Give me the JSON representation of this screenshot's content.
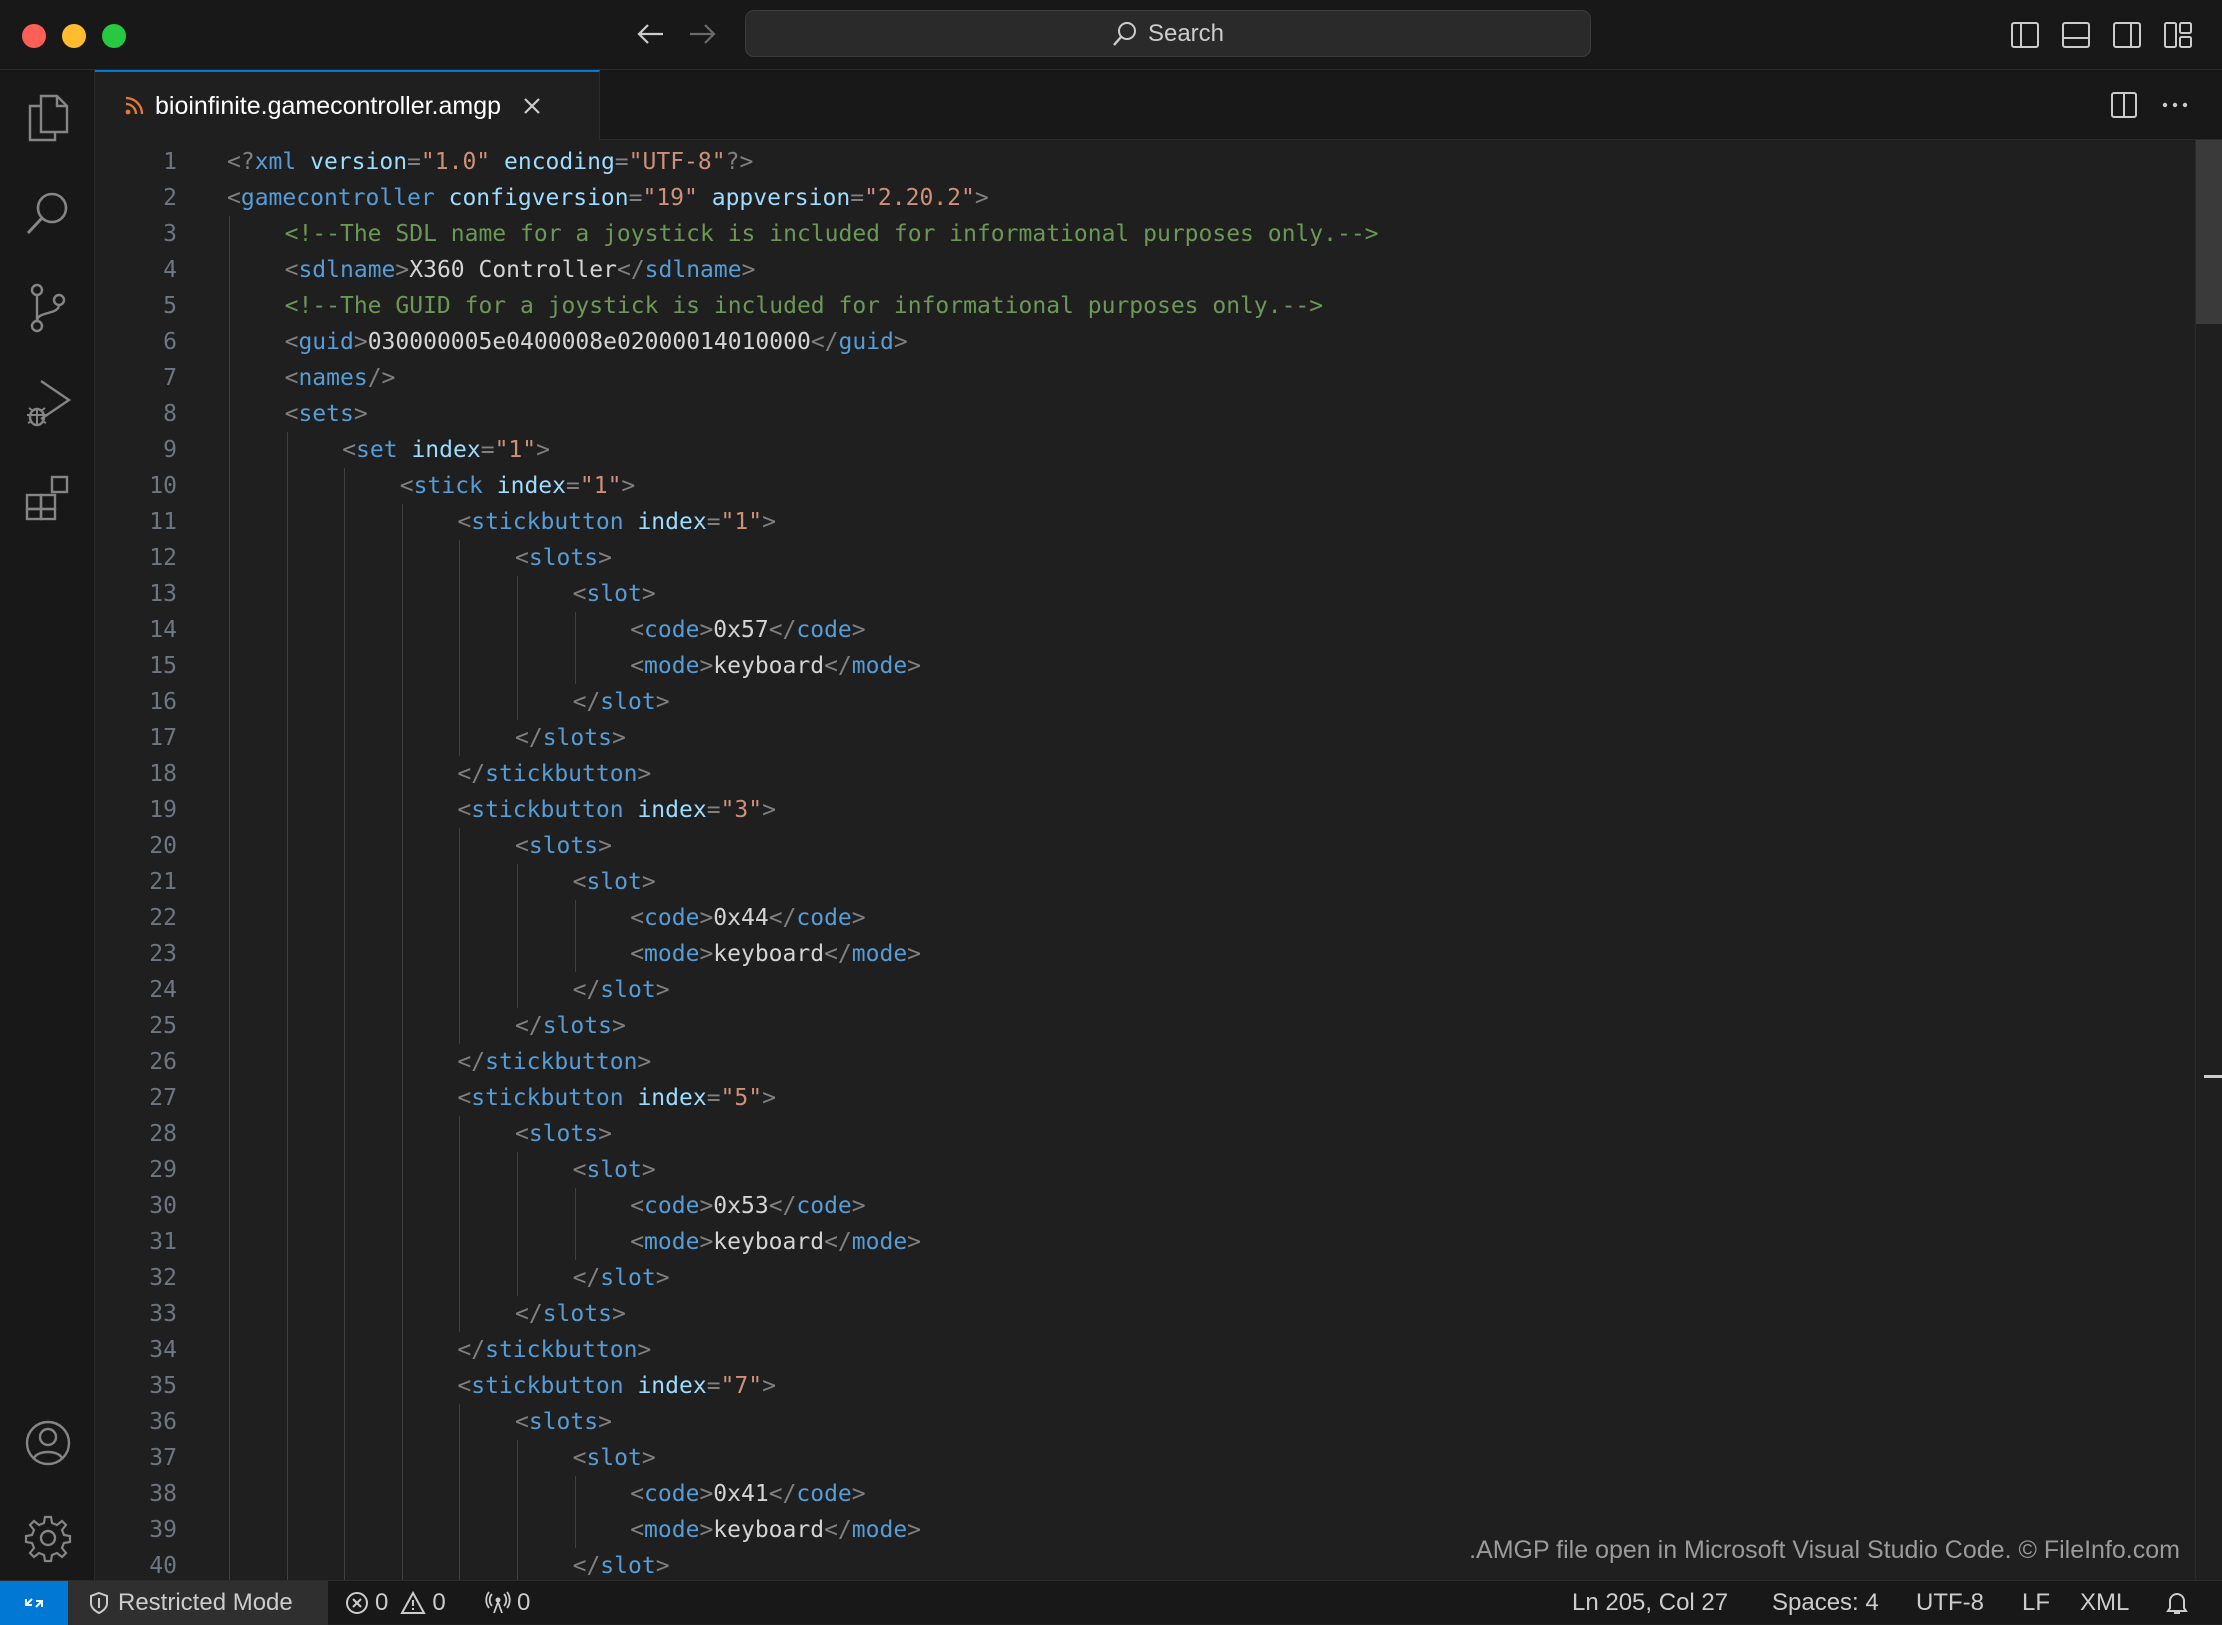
{
  "window": {
    "traffic_colors": {
      "close": "#ff5f57",
      "minimize": "#febc2e",
      "maximize": "#28c840"
    }
  },
  "titlebar": {
    "search_label": "Search"
  },
  "tab": {
    "filename": "bioinfinite.gamecontroller.amgp",
    "icon": "rss-icon"
  },
  "editor": {
    "lines": [
      {
        "n": "1",
        "depth": 0,
        "t": [
          [
            "b",
            "<?"
          ],
          [
            "n",
            "xml"
          ],
          [
            "x",
            " "
          ],
          [
            "a",
            "version"
          ],
          [
            "b",
            "="
          ],
          [
            "s",
            "\"1.0\""
          ],
          [
            "x",
            " "
          ],
          [
            "a",
            "encoding"
          ],
          [
            "b",
            "="
          ],
          [
            "s",
            "\"UTF-8\""
          ],
          [
            "b",
            "?>"
          ]
        ]
      },
      {
        "n": "2",
        "depth": 0,
        "t": [
          [
            "b",
            "<"
          ],
          [
            "n",
            "gamecontroller"
          ],
          [
            "x",
            " "
          ],
          [
            "a",
            "configversion"
          ],
          [
            "b",
            "="
          ],
          [
            "s",
            "\"19\""
          ],
          [
            "x",
            " "
          ],
          [
            "a",
            "appversion"
          ],
          [
            "b",
            "="
          ],
          [
            "s",
            "\"2.20.2\""
          ],
          [
            "b",
            ">"
          ]
        ]
      },
      {
        "n": "3",
        "depth": 1,
        "t": [
          [
            "c",
            "<!--The SDL name for a joystick is included for informational purposes only.-->"
          ]
        ]
      },
      {
        "n": "4",
        "depth": 1,
        "t": [
          [
            "b",
            "<"
          ],
          [
            "n",
            "sdlname"
          ],
          [
            "b",
            ">"
          ],
          [
            "x",
            "X360 Controller"
          ],
          [
            "b",
            "</"
          ],
          [
            "n",
            "sdlname"
          ],
          [
            "b",
            ">"
          ]
        ]
      },
      {
        "n": "5",
        "depth": 1,
        "t": [
          [
            "c",
            "<!--The GUID for a joystick is included for informational purposes only.-->"
          ]
        ]
      },
      {
        "n": "6",
        "depth": 1,
        "t": [
          [
            "b",
            "<"
          ],
          [
            "n",
            "guid"
          ],
          [
            "b",
            ">"
          ],
          [
            "x",
            "030000005e0400008e02000014010000"
          ],
          [
            "b",
            "</"
          ],
          [
            "n",
            "guid"
          ],
          [
            "b",
            ">"
          ]
        ]
      },
      {
        "n": "7",
        "depth": 1,
        "t": [
          [
            "b",
            "<"
          ],
          [
            "n",
            "names"
          ],
          [
            "b",
            "/>"
          ]
        ]
      },
      {
        "n": "8",
        "depth": 1,
        "t": [
          [
            "b",
            "<"
          ],
          [
            "n",
            "sets"
          ],
          [
            "b",
            ">"
          ]
        ]
      },
      {
        "n": "9",
        "depth": 2,
        "t": [
          [
            "b",
            "<"
          ],
          [
            "n",
            "set"
          ],
          [
            "x",
            " "
          ],
          [
            "a",
            "index"
          ],
          [
            "b",
            "="
          ],
          [
            "s",
            "\"1\""
          ],
          [
            "b",
            ">"
          ]
        ]
      },
      {
        "n": "10",
        "depth": 3,
        "t": [
          [
            "b",
            "<"
          ],
          [
            "n",
            "stick"
          ],
          [
            "x",
            " "
          ],
          [
            "a",
            "index"
          ],
          [
            "b",
            "="
          ],
          [
            "s",
            "\"1\""
          ],
          [
            "b",
            ">"
          ]
        ]
      },
      {
        "n": "11",
        "depth": 4,
        "t": [
          [
            "b",
            "<"
          ],
          [
            "n",
            "stickbutton"
          ],
          [
            "x",
            " "
          ],
          [
            "a",
            "index"
          ],
          [
            "b",
            "="
          ],
          [
            "s",
            "\"1\""
          ],
          [
            "b",
            ">"
          ]
        ]
      },
      {
        "n": "12",
        "depth": 5,
        "t": [
          [
            "b",
            "<"
          ],
          [
            "n",
            "slots"
          ],
          [
            "b",
            ">"
          ]
        ]
      },
      {
        "n": "13",
        "depth": 6,
        "t": [
          [
            "b",
            "<"
          ],
          [
            "n",
            "slot"
          ],
          [
            "b",
            ">"
          ]
        ]
      },
      {
        "n": "14",
        "depth": 7,
        "t": [
          [
            "b",
            "<"
          ],
          [
            "n",
            "code"
          ],
          [
            "b",
            ">"
          ],
          [
            "x",
            "0x57"
          ],
          [
            "b",
            "</"
          ],
          [
            "n",
            "code"
          ],
          [
            "b",
            ">"
          ]
        ]
      },
      {
        "n": "15",
        "depth": 7,
        "t": [
          [
            "b",
            "<"
          ],
          [
            "n",
            "mode"
          ],
          [
            "b",
            ">"
          ],
          [
            "x",
            "keyboard"
          ],
          [
            "b",
            "</"
          ],
          [
            "n",
            "mode"
          ],
          [
            "b",
            ">"
          ]
        ]
      },
      {
        "n": "16",
        "depth": 6,
        "t": [
          [
            "b",
            "</"
          ],
          [
            "n",
            "slot"
          ],
          [
            "b",
            ">"
          ]
        ]
      },
      {
        "n": "17",
        "depth": 5,
        "t": [
          [
            "b",
            "</"
          ],
          [
            "n",
            "slots"
          ],
          [
            "b",
            ">"
          ]
        ]
      },
      {
        "n": "18",
        "depth": 4,
        "t": [
          [
            "b",
            "</"
          ],
          [
            "n",
            "stickbutton"
          ],
          [
            "b",
            ">"
          ]
        ]
      },
      {
        "n": "19",
        "depth": 4,
        "t": [
          [
            "b",
            "<"
          ],
          [
            "n",
            "stickbutton"
          ],
          [
            "x",
            " "
          ],
          [
            "a",
            "index"
          ],
          [
            "b",
            "="
          ],
          [
            "s",
            "\"3\""
          ],
          [
            "b",
            ">"
          ]
        ]
      },
      {
        "n": "20",
        "depth": 5,
        "t": [
          [
            "b",
            "<"
          ],
          [
            "n",
            "slots"
          ],
          [
            "b",
            ">"
          ]
        ]
      },
      {
        "n": "21",
        "depth": 6,
        "t": [
          [
            "b",
            "<"
          ],
          [
            "n",
            "slot"
          ],
          [
            "b",
            ">"
          ]
        ]
      },
      {
        "n": "22",
        "depth": 7,
        "t": [
          [
            "b",
            "<"
          ],
          [
            "n",
            "code"
          ],
          [
            "b",
            ">"
          ],
          [
            "x",
            "0x44"
          ],
          [
            "b",
            "</"
          ],
          [
            "n",
            "code"
          ],
          [
            "b",
            ">"
          ]
        ]
      },
      {
        "n": "23",
        "depth": 7,
        "t": [
          [
            "b",
            "<"
          ],
          [
            "n",
            "mode"
          ],
          [
            "b",
            ">"
          ],
          [
            "x",
            "keyboard"
          ],
          [
            "b",
            "</"
          ],
          [
            "n",
            "mode"
          ],
          [
            "b",
            ">"
          ]
        ]
      },
      {
        "n": "24",
        "depth": 6,
        "t": [
          [
            "b",
            "</"
          ],
          [
            "n",
            "slot"
          ],
          [
            "b",
            ">"
          ]
        ]
      },
      {
        "n": "25",
        "depth": 5,
        "t": [
          [
            "b",
            "</"
          ],
          [
            "n",
            "slots"
          ],
          [
            "b",
            ">"
          ]
        ]
      },
      {
        "n": "26",
        "depth": 4,
        "t": [
          [
            "b",
            "</"
          ],
          [
            "n",
            "stickbutton"
          ],
          [
            "b",
            ">"
          ]
        ]
      },
      {
        "n": "27",
        "depth": 4,
        "t": [
          [
            "b",
            "<"
          ],
          [
            "n",
            "stickbutton"
          ],
          [
            "x",
            " "
          ],
          [
            "a",
            "index"
          ],
          [
            "b",
            "="
          ],
          [
            "s",
            "\"5\""
          ],
          [
            "b",
            ">"
          ]
        ]
      },
      {
        "n": "28",
        "depth": 5,
        "t": [
          [
            "b",
            "<"
          ],
          [
            "n",
            "slots"
          ],
          [
            "b",
            ">"
          ]
        ]
      },
      {
        "n": "29",
        "depth": 6,
        "t": [
          [
            "b",
            "<"
          ],
          [
            "n",
            "slot"
          ],
          [
            "b",
            ">"
          ]
        ]
      },
      {
        "n": "30",
        "depth": 7,
        "t": [
          [
            "b",
            "<"
          ],
          [
            "n",
            "code"
          ],
          [
            "b",
            ">"
          ],
          [
            "x",
            "0x53"
          ],
          [
            "b",
            "</"
          ],
          [
            "n",
            "code"
          ],
          [
            "b",
            ">"
          ]
        ]
      },
      {
        "n": "31",
        "depth": 7,
        "t": [
          [
            "b",
            "<"
          ],
          [
            "n",
            "mode"
          ],
          [
            "b",
            ">"
          ],
          [
            "x",
            "keyboard"
          ],
          [
            "b",
            "</"
          ],
          [
            "n",
            "mode"
          ],
          [
            "b",
            ">"
          ]
        ]
      },
      {
        "n": "32",
        "depth": 6,
        "t": [
          [
            "b",
            "</"
          ],
          [
            "n",
            "slot"
          ],
          [
            "b",
            ">"
          ]
        ]
      },
      {
        "n": "33",
        "depth": 5,
        "t": [
          [
            "b",
            "</"
          ],
          [
            "n",
            "slots"
          ],
          [
            "b",
            ">"
          ]
        ]
      },
      {
        "n": "34",
        "depth": 4,
        "t": [
          [
            "b",
            "</"
          ],
          [
            "n",
            "stickbutton"
          ],
          [
            "b",
            ">"
          ]
        ]
      },
      {
        "n": "35",
        "depth": 4,
        "t": [
          [
            "b",
            "<"
          ],
          [
            "n",
            "stickbutton"
          ],
          [
            "x",
            " "
          ],
          [
            "a",
            "index"
          ],
          [
            "b",
            "="
          ],
          [
            "s",
            "\"7\""
          ],
          [
            "b",
            ">"
          ]
        ]
      },
      {
        "n": "36",
        "depth": 5,
        "t": [
          [
            "b",
            "<"
          ],
          [
            "n",
            "slots"
          ],
          [
            "b",
            ">"
          ]
        ]
      },
      {
        "n": "37",
        "depth": 6,
        "t": [
          [
            "b",
            "<"
          ],
          [
            "n",
            "slot"
          ],
          [
            "b",
            ">"
          ]
        ]
      },
      {
        "n": "38",
        "depth": 7,
        "t": [
          [
            "b",
            "<"
          ],
          [
            "n",
            "code"
          ],
          [
            "b",
            ">"
          ],
          [
            "x",
            "0x41"
          ],
          [
            "b",
            "</"
          ],
          [
            "n",
            "code"
          ],
          [
            "b",
            ">"
          ]
        ]
      },
      {
        "n": "39",
        "depth": 7,
        "t": [
          [
            "b",
            "<"
          ],
          [
            "n",
            "mode"
          ],
          [
            "b",
            ">"
          ],
          [
            "x",
            "keyboard"
          ],
          [
            "b",
            "</"
          ],
          [
            "n",
            "mode"
          ],
          [
            "b",
            ">"
          ]
        ]
      },
      {
        "n": "40",
        "depth": 6,
        "t": [
          [
            "b",
            "</"
          ],
          [
            "n",
            "slot"
          ],
          [
            "b",
            ">"
          ]
        ]
      }
    ]
  },
  "statusbar": {
    "restricted_mode": "Restricted Mode",
    "errors": "0",
    "warnings": "0",
    "ports": "0",
    "cursor": "Ln 205, Col 27",
    "spaces": "Spaces: 4",
    "encoding": "UTF-8",
    "eol": "LF",
    "language": "XML"
  },
  "watermark": ".AMGP file open in Microsoft Visual Studio Code. © FileInfo.com"
}
